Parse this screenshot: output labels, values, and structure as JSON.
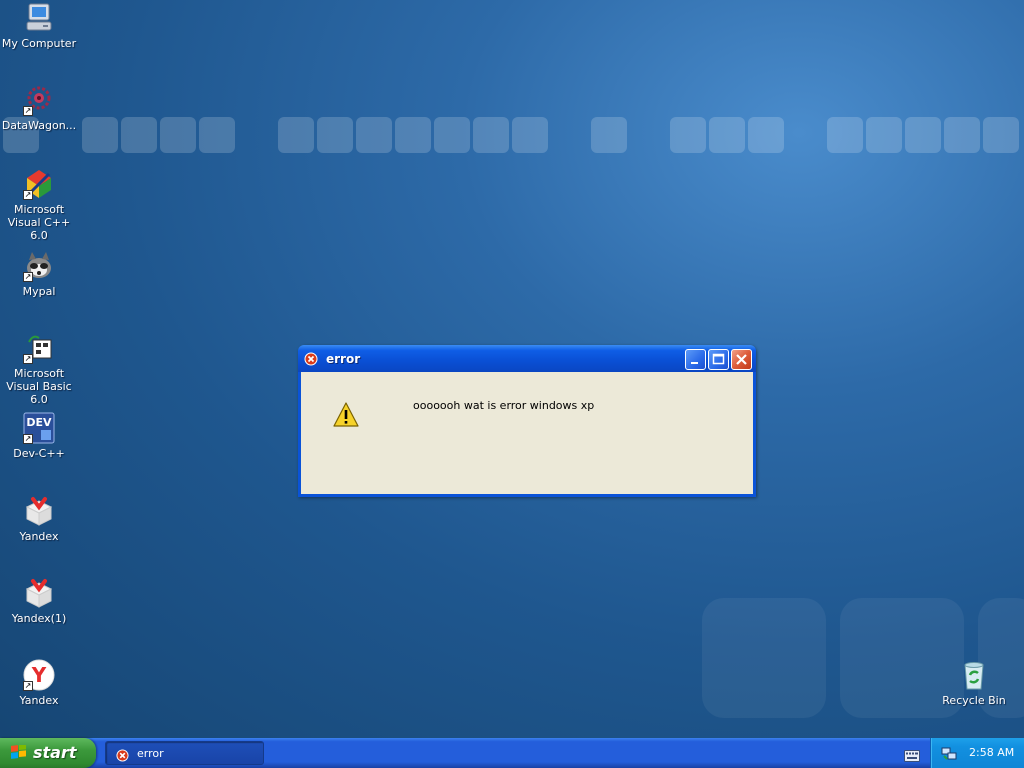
{
  "desktop": {
    "icons": [
      {
        "label": "My Computer",
        "icon": "my-computer-icon"
      },
      {
        "label": "DataWagon...",
        "icon": "datawagon-icon"
      },
      {
        "label": "Microsoft Visual C++ 6.0",
        "icon": "visual-cpp-icon"
      },
      {
        "label": "Mypal",
        "icon": "mypal-icon"
      },
      {
        "label": "Microsoft Visual Basic 6.0",
        "icon": "visual-basic-icon"
      },
      {
        "label": "Dev-C++",
        "icon": "dev-cpp-icon",
        "badge": "DEV"
      },
      {
        "label": "Yandex",
        "icon": "yandex-icon"
      },
      {
        "label": "Yandex(1)",
        "icon": "yandex-icon"
      },
      {
        "label": "Yandex",
        "icon": "yandex-browser-icon",
        "badge": "Y"
      },
      {
        "label": "Recycle Bin",
        "icon": "recycle-bin-icon"
      }
    ],
    "colors": {
      "background": "#2d6aa8",
      "tile": "#ffffff"
    }
  },
  "dialog": {
    "title": "error",
    "message": "ooooooh wat is error windows xp",
    "icon": "warning-icon",
    "buttons": [
      "minimize",
      "maximize",
      "close"
    ],
    "colors": {
      "titlebar": "#0a4fd4",
      "client": "#ece9d8",
      "close_button": "#dd5c3a"
    }
  },
  "taskbar": {
    "start_label": "start",
    "tasks": [
      {
        "label": "error",
        "icon": "error-icon"
      }
    ],
    "tray": {
      "clock": "2:58 AM",
      "icons": [
        "network-icon"
      ]
    },
    "language_icon": "keyboard-icon",
    "colors": {
      "taskbar": "#245edb",
      "start": "#3c993c",
      "tray": "#1290e0"
    }
  }
}
